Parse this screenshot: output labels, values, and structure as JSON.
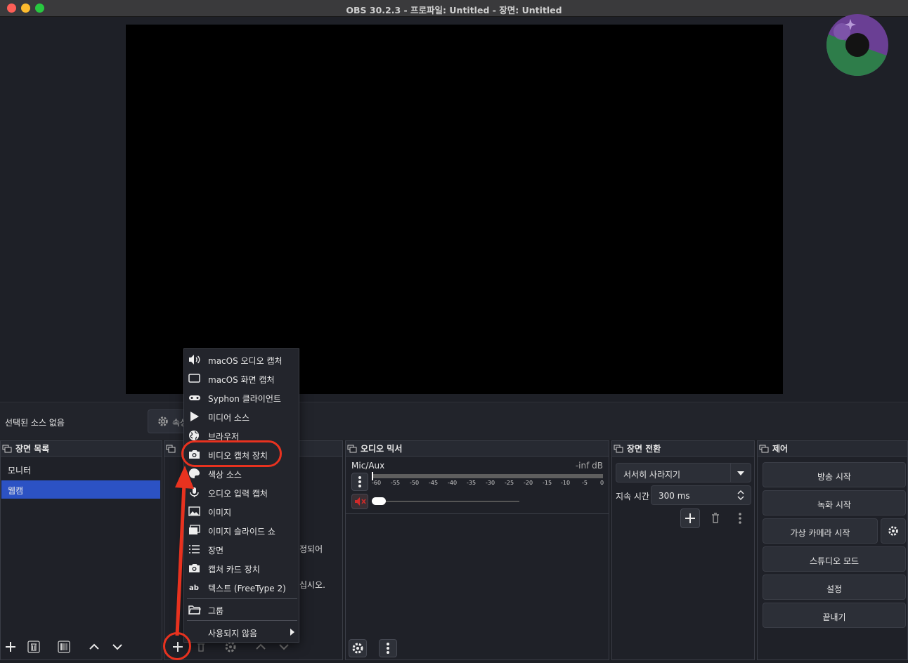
{
  "window": {
    "title": "OBS 30.2.3 - 프로파일: Untitled - 장면: Untitled"
  },
  "source_bar": {
    "no_source": "선택된 소스 없음",
    "properties_label": "속성"
  },
  "scenes": {
    "title": "장면 목록",
    "items": [
      {
        "label": "모니터",
        "selected": false
      },
      {
        "label": "웹캠",
        "selected": true
      }
    ]
  },
  "sources": {
    "behind_text_1": "정되어",
    "behind_text_2": "십시오."
  },
  "add_source_menu": {
    "items": [
      {
        "label": "macOS 오디오 캡처",
        "icon": "speaker-icon"
      },
      {
        "label": "macOS 화면 캡처",
        "icon": "monitor-icon"
      },
      {
        "label": "Syphon 클라이언트",
        "icon": "gamepad-icon"
      },
      {
        "label": "미디어 소스",
        "icon": "play-icon"
      },
      {
        "label": "브라우저",
        "icon": "globe-icon"
      },
      {
        "label": "비디오 캡처 장치",
        "icon": "camera-icon"
      },
      {
        "label": "색상 소스",
        "icon": "palette-icon"
      },
      {
        "label": "오디오 입력 캡처",
        "icon": "mic-icon"
      },
      {
        "label": "이미지",
        "icon": "image-icon"
      },
      {
        "label": "이미지 슬라이드 쇼",
        "icon": "slideshow-icon"
      },
      {
        "label": "장면",
        "icon": "list-icon"
      },
      {
        "label": "캡처 카드 장치",
        "icon": "camera-icon"
      },
      {
        "label": "텍스트 (FreeType 2)",
        "icon": "text-icon"
      },
      {
        "label": "그룹",
        "icon": "folder-icon"
      },
      {
        "label": "사용되지 않음",
        "icon": ""
      }
    ],
    "highlighted_index": 5
  },
  "mixer": {
    "title": "오디오 믹서",
    "track": {
      "name": "Mic/Aux",
      "level": "-inf dB",
      "muted": true
    },
    "scale": [
      "-60",
      "-55",
      "-50",
      "-45",
      "-40",
      "-35",
      "-30",
      "-25",
      "-20",
      "-15",
      "-10",
      "-5",
      "0"
    ]
  },
  "transitions": {
    "title": "장면 전환",
    "selected": "서서히 사라지기",
    "duration_label": "지속 시간",
    "duration_value": "300 ms"
  },
  "controls": {
    "title": "제어",
    "start_stream": "방송 시작",
    "start_record": "녹화 시작",
    "virtual_cam": "가상 카메라 시작",
    "studio_mode": "스튜디오 모드",
    "settings": "설정",
    "exit": "끝내기"
  },
  "colors": {
    "accent_selected": "#2c52c4",
    "highlight_red": "#e8321f",
    "logo_purple": "#6a3f94",
    "logo_green": "#2e7d4a"
  }
}
